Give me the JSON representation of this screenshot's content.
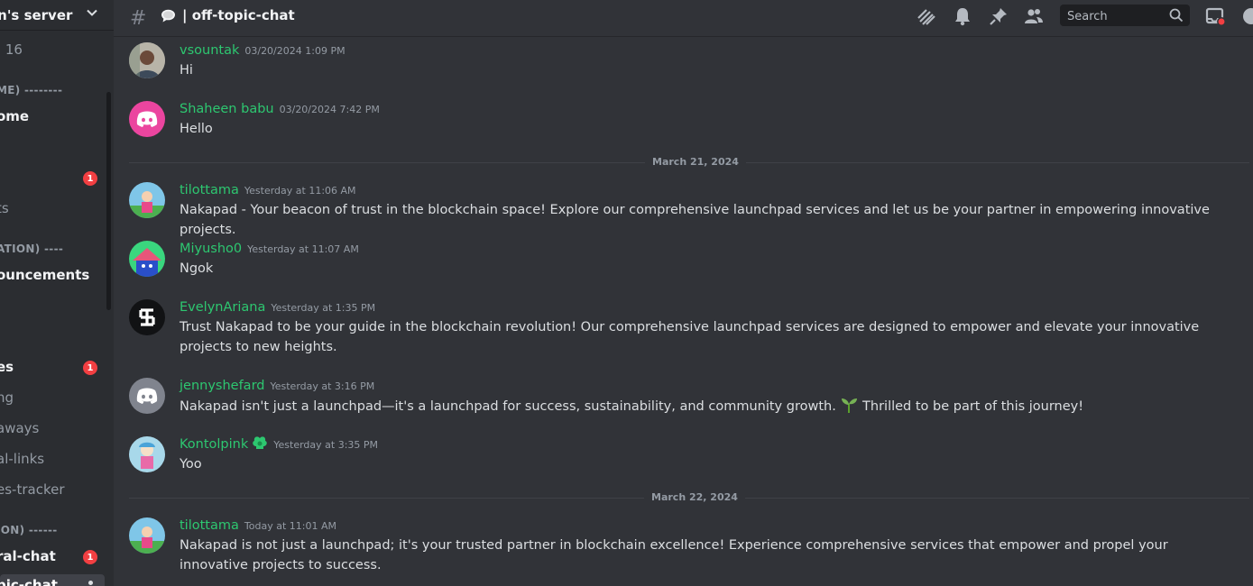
{
  "sidebar": {
    "server_name": "in's server",
    "items": [
      {
        "label": ": 16",
        "style": "dim"
      },
      {
        "label": "ME) --------",
        "style": "cat"
      },
      {
        "label": "ome",
        "style": "bright"
      },
      {
        "label": "ts",
        "style": "dim"
      },
      {
        "label": "ATION) ----",
        "style": "cat"
      },
      {
        "label": "ouncements",
        "style": "bright"
      },
      {
        "label": "es",
        "style": "bright"
      },
      {
        "label": "ng",
        "style": "dim"
      },
      {
        "label": "aways",
        "style": "dim"
      },
      {
        "label": "al-links",
        "style": "dim"
      },
      {
        "label": "es-tracker",
        "style": "dim"
      },
      {
        "label": "ION) ------",
        "style": "cat"
      },
      {
        "label": "ral-chat",
        "style": "bright"
      },
      {
        "label": "pic-chat",
        "style": "bright"
      }
    ],
    "badges": [
      "1",
      "1",
      "1"
    ]
  },
  "header": {
    "hash": "#",
    "channel": "| off-topic-chat",
    "search_placeholder": "Search",
    "icons": [
      "threads-icon",
      "bell-icon",
      "pin-icon",
      "members-icon",
      "search-icon",
      "inbox-icon",
      "help-icon"
    ]
  },
  "dividers": [
    "March 21, 2024",
    "March 22, 2024"
  ],
  "messages": [
    {
      "user": "vsountak",
      "time": "03/20/2024 1:09 PM",
      "text": "Hi"
    },
    {
      "user": "Shaheen babu",
      "time": "03/20/2024 7:42 PM",
      "text": "Hello"
    },
    {
      "user": "tilottama",
      "time": "Yesterday at 11:06 AM",
      "text": "Nakapad - Your beacon of trust in the blockchain space! Explore our comprehensive launchpad services and let us be your partner in empowering innovative projects."
    },
    {
      "user": "Miyusho0",
      "time": "Yesterday at 11:07 AM",
      "text": "Ngok"
    },
    {
      "user": "EvelynAriana",
      "time": "Yesterday at 1:35 PM",
      "text": "Trust Nakapad to be your guide in the blockchain revolution! Our comprehensive launchpad services are designed to empower and elevate your innovative projects to new heights."
    },
    {
      "user": "jennyshefard",
      "time": "Yesterday at 3:16 PM",
      "text": "Nakapad isn't just a launchpad—it's a launchpad for success, sustainability, and community growth.",
      "text_after": " Thrilled to be part of this journey!"
    },
    {
      "user": "Kontolpink",
      "time": "Yesterday at 3:35 PM",
      "text": "Yoo"
    },
    {
      "user": "tilottama",
      "time": "Today at 11:01 AM",
      "text": "Nakapad is not just a launchpad; it's your trusted partner in blockchain excellence! Experience comprehensive services that empower and propel your innovative projects to success."
    }
  ],
  "colors": {
    "username": "#2dc770",
    "badge": "#f23f42",
    "bg": "#313338",
    "sidebar": "#2b2d31"
  }
}
